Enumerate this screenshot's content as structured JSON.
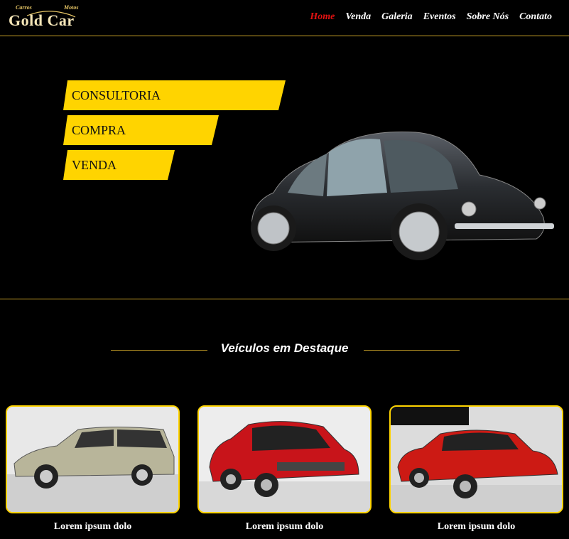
{
  "header": {
    "logo": {
      "small_left": "Carros",
      "small_right": "Motos",
      "main": "Gold Car"
    },
    "nav": [
      {
        "label": "Home",
        "active": true
      },
      {
        "label": "Venda",
        "active": false
      },
      {
        "label": "Galeria",
        "active": false
      },
      {
        "label": "Eventos",
        "active": false
      },
      {
        "label": "Sobre Nós",
        "active": false
      },
      {
        "label": "Contato",
        "active": false
      }
    ]
  },
  "hero": {
    "ribbons": [
      "CONSULTORIA",
      "COMPRA",
      "VENDA"
    ]
  },
  "featured": {
    "title": "Veículos em Destaque",
    "cards": [
      {
        "title": "Lorem ipsum dolo"
      },
      {
        "title": "Lorem ipsum dolo"
      },
      {
        "title": "Lorem ipsum dolo"
      }
    ]
  },
  "colors": {
    "accent": "#ffd400",
    "active_nav": "#e31212",
    "background": "#000000",
    "divider": "#c9a227"
  }
}
